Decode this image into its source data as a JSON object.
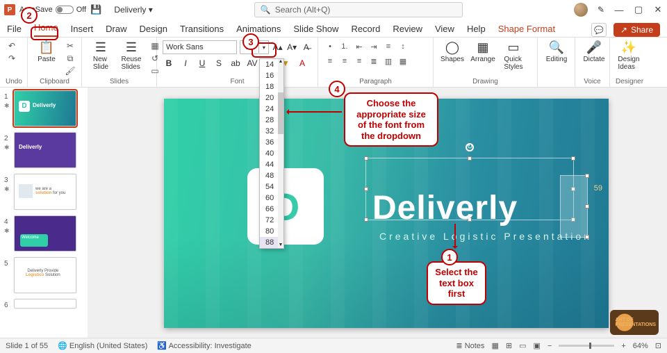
{
  "titlebar": {
    "autosave_label": "AutoSave",
    "autosave_state": "Off",
    "doc_title": "Deliverly ▾",
    "search_placeholder": "Search (Alt+Q)"
  },
  "tabs": [
    "File",
    "Home",
    "Insert",
    "Draw",
    "Design",
    "Transitions",
    "Animations",
    "Slide Show",
    "Record",
    "Review",
    "View",
    "Help",
    "Shape Format"
  ],
  "active_tab": "Home",
  "share_label": "Share",
  "ribbon": {
    "undo": {
      "label": "Undo"
    },
    "clipboard": {
      "label": "Clipboard",
      "paste": "Paste"
    },
    "slides": {
      "label": "Slides",
      "new": "New\nSlide",
      "reuse": "Reuse\nSlides"
    },
    "font": {
      "label": "Font",
      "name": "Work Sans",
      "size": "88",
      "sizes": [
        "14",
        "16",
        "18",
        "20",
        "24",
        "28",
        "32",
        "36",
        "40",
        "44",
        "48",
        "54",
        "60",
        "66",
        "72",
        "80",
        "88"
      ],
      "increase": "A▴",
      "decrease": "A▾",
      "clear": "A̶"
    },
    "paragraph": {
      "label": "Paragraph"
    },
    "drawing": {
      "label": "Drawing",
      "shapes": "Shapes",
      "arrange": "Arrange",
      "styles": "Quick\nStyles"
    },
    "editing": {
      "label": "Editing",
      "btn": "Editing"
    },
    "voice": {
      "label": "Voice",
      "btn": "Dictate"
    },
    "designer": {
      "label": "Designer",
      "btn": "Design\nIdeas"
    }
  },
  "slide": {
    "title": "Deliverly",
    "subtitle": "Creative Logistic Presentation",
    "num_label": "59"
  },
  "thumbs": {
    "count": 6
  },
  "callouts": {
    "c1": "Select the\ntext box\nfirst",
    "c4": "Choose the\nappropriate size\nof the font from\nthe dropdown"
  },
  "status": {
    "slide": "Slide 1 of 55",
    "lang": "English (United States)",
    "access": "Accessibility: Investigate",
    "notes": "Notes",
    "zoom": "64%"
  },
  "watermark": "ART OF\nPRESENTATIONS"
}
